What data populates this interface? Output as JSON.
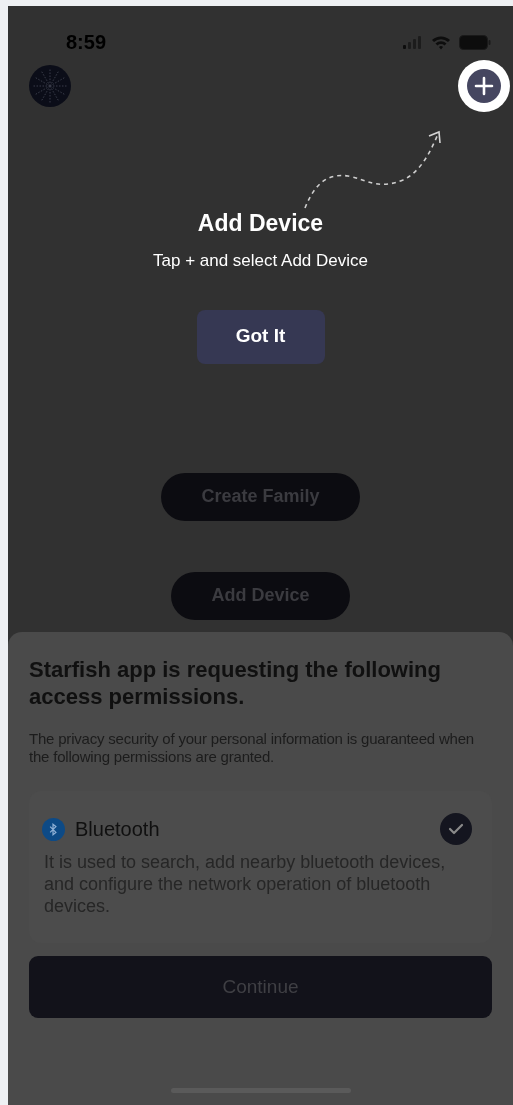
{
  "status_bar": {
    "time": "8:59"
  },
  "coach_mark": {
    "title": "Add Device",
    "hint": "Tap + and select Add Device",
    "button": "Got It"
  },
  "background_buttons": [
    "Create Family",
    "Add Device"
  ],
  "permission_sheet": {
    "title": "Starfish app is requesting the following access permissions.",
    "subtitle": "The privacy security of your personal information is guaranteed when the following permissions are granted.",
    "permissions": [
      {
        "kind": "bluetooth",
        "name": "Bluetooth",
        "description": "It is used to search, add nearby bluetooth devices, and configure the network operation of bluetooth devices.",
        "checked": true
      }
    ],
    "button": "Continue"
  }
}
